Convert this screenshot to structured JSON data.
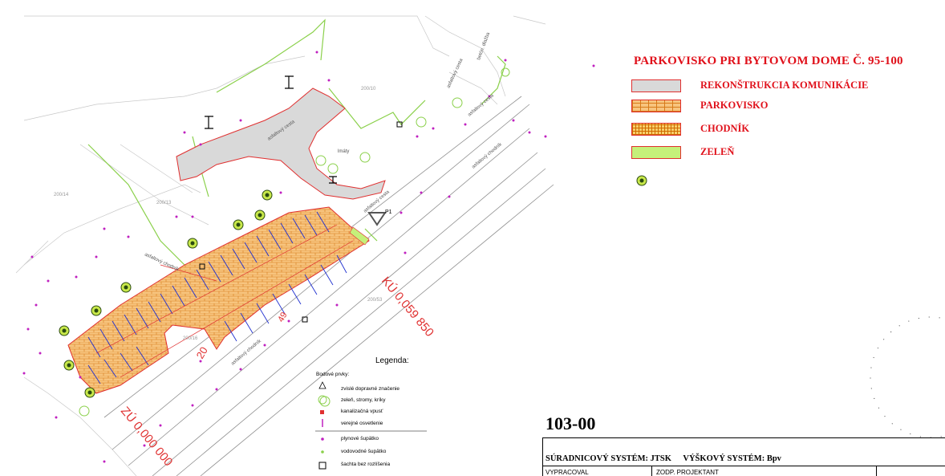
{
  "legend": {
    "title": "PARKOVISKO PRI BYTOVOM DOME Č. 95-100",
    "items": [
      {
        "label": "REKONŠTRUKCIA KOMUNIKÁCIE",
        "fill": "#d9d9d9"
      },
      {
        "label": "PARKOVISKO",
        "fill": "#f7c47e"
      },
      {
        "label": "CHODNÍK",
        "fill": "#f7cf6a"
      },
      {
        "label": "ZELEŇ",
        "fill": "#c5f07a"
      }
    ]
  },
  "map_labels": {
    "ku_label": "KÚ 0,059 850",
    "zu_label": "ZÚ 0,000 000",
    "road_label_1": "asfaltový cesta",
    "road_label_2": "asfaltový chodník",
    "road_label_3": "asfaltový cesta",
    "road_label_4": "asfaltový chodník",
    "road_label_5": "asfaltový cesta",
    "road_label_6": "asfaltový cesta",
    "road_label_7": "asfaltový chodník",
    "road_label_8": "betón. dlažba",
    "parcel_1": "200/14",
    "parcel_2": "200/13",
    "parcel_3": "200/10",
    "parcel_4": "200/53",
    "parcel_5": "200/16",
    "lamp_label": "lmáty",
    "p1": "P1",
    "dim_1": "20",
    "dim_2": "49"
  },
  "map_legend": {
    "title": "Legenda:",
    "subtitle": "Bodové prvky:",
    "items": [
      "zvislé dopravné značenie",
      "zeleň, stromy, kríky",
      "kanalizačná vpusť",
      "verejné osvetlenie",
      "plynové šupätko",
      "vodovodné šupätko",
      "šachta bez rozlíšenia"
    ]
  },
  "title_block": {
    "code": "103-00",
    "coord_system": "SÚRADNICOVÝ SYSTÉM: JTSK",
    "height_system": "VÝŠKOVÝ SYSTÉM: Bpv",
    "drawn_by": "VYPRACOVAL",
    "responsible": "ZODP. PROJEKTANT"
  },
  "colors": {
    "road_gray": "#d9d9d9",
    "parking_orange": "#f7c47e",
    "hatch": "#d77a1a",
    "outline_red": "#e03030",
    "green_edge": "#8ad04a",
    "magenta_marks": "#c020c0",
    "blue_lines": "#2030d0"
  }
}
